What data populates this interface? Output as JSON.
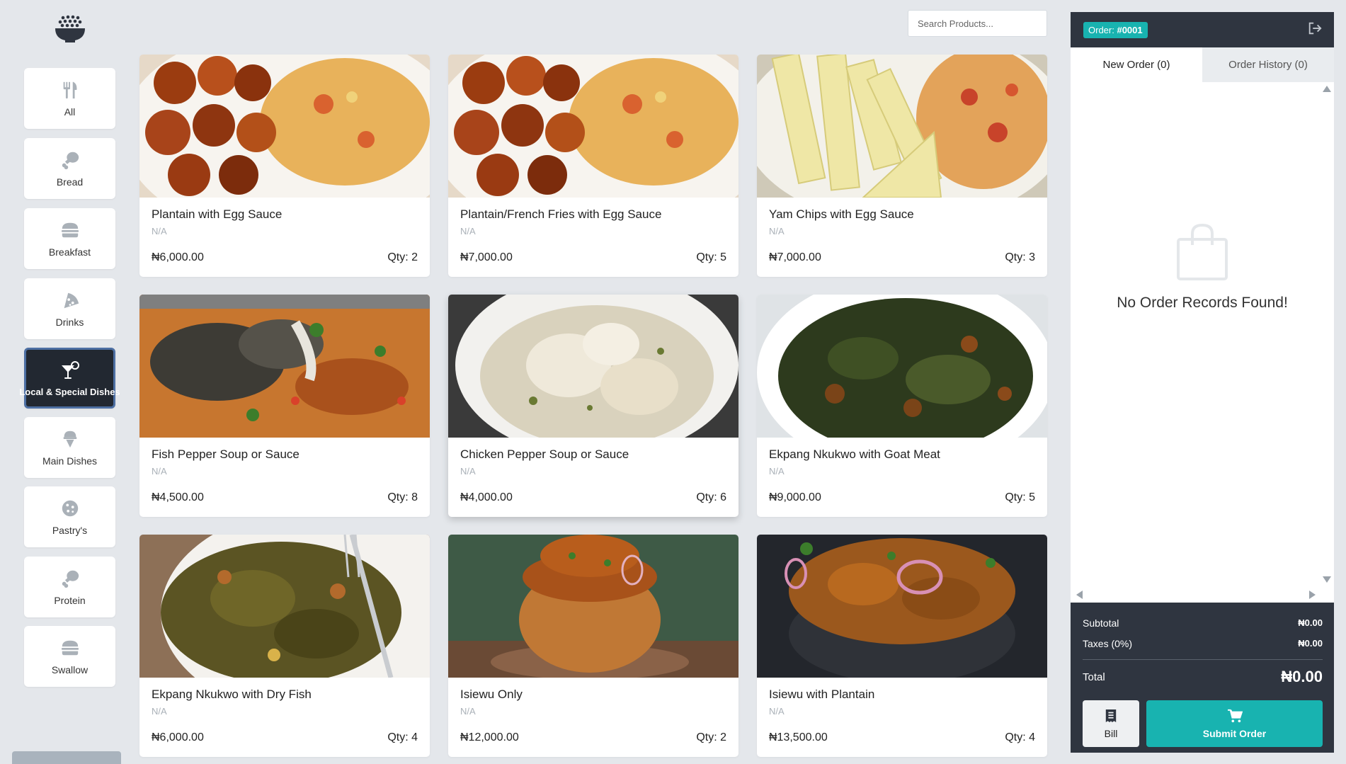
{
  "search": {
    "placeholder": "Search Products..."
  },
  "categories": [
    {
      "label": "All",
      "icon": "utensils-icon"
    },
    {
      "label": "Bread",
      "icon": "drumstick-icon"
    },
    {
      "label": "Breakfast",
      "icon": "burger-icon"
    },
    {
      "label": "Drinks",
      "icon": "pizza-icon"
    },
    {
      "label": "Local & Special Dishes",
      "icon": "cocktail-icon",
      "active": true
    },
    {
      "label": "Main Dishes",
      "icon": "ice-cream-icon"
    },
    {
      "label": "Pastry's",
      "icon": "cookie-icon"
    },
    {
      "label": "Protein",
      "icon": "drumstick-icon"
    },
    {
      "label": "Swallow",
      "icon": "burger-icon"
    }
  ],
  "products": [
    {
      "name": "Plantain with Egg Sauce",
      "desc": "N/A",
      "price": "₦6,000.00",
      "qty": "Qty: 2"
    },
    {
      "name": "Plantain/French Fries with Egg Sauce",
      "desc": "N/A",
      "price": "₦7,000.00",
      "qty": "Qty: 5"
    },
    {
      "name": "Yam Chips with Egg Sauce",
      "desc": "N/A",
      "price": "₦7,000.00",
      "qty": "Qty: 3"
    },
    {
      "name": "Fish Pepper Soup or Sauce",
      "desc": "N/A",
      "price": "₦4,500.00",
      "qty": "Qty: 8"
    },
    {
      "name": "Chicken Pepper Soup or Sauce",
      "desc": "N/A",
      "price": "₦4,000.00",
      "qty": "Qty: 6"
    },
    {
      "name": "Ekpang Nkukwo with Goat Meat",
      "desc": "N/A",
      "price": "₦9,000.00",
      "qty": "Qty: 5"
    },
    {
      "name": "Ekpang Nkukwo with Dry Fish",
      "desc": "N/A",
      "price": "₦6,000.00",
      "qty": "Qty: 4"
    },
    {
      "name": "Isiewu Only",
      "desc": "N/A",
      "price": "₦12,000.00",
      "qty": "Qty: 2"
    },
    {
      "name": "Isiewu with Plantain",
      "desc": "N/A",
      "price": "₦13,500.00",
      "qty": "Qty: 4"
    }
  ],
  "order": {
    "badge_prefix": "Order:",
    "badge_number": "#0001",
    "tab_new": "New Order (0)",
    "tab_history": "Order History (0)",
    "empty_message": "No Order Records Found!",
    "subtotal_label": "Subtotal",
    "subtotal_value": "₦0.00",
    "taxes_label": "Taxes (0%)",
    "taxes_value": "₦0.00",
    "total_label": "Total",
    "total_value": "₦0.00",
    "bill_label": "Bill",
    "submit_label": "Submit Order"
  },
  "colors": {
    "accent": "#18b3b0",
    "dark": "#2f3540",
    "active_category": "#222831"
  }
}
